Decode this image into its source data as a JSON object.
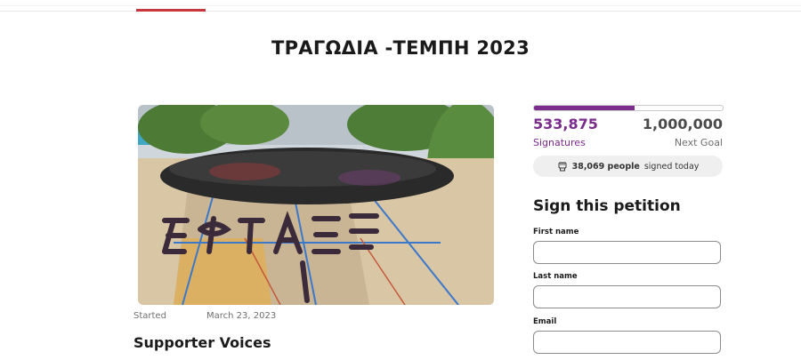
{
  "page": {
    "title": "ΤΡΑΓΩΔΙΑ -ΤΕΜΠΗ 2023"
  },
  "hero_image": {
    "description_icon": "photo-icon",
    "painted_text": "ΕΦΤΑΙΞΕΣ"
  },
  "meta": {
    "started_label": "Started",
    "started_date": "March 23, 2023"
  },
  "supporters": {
    "heading": "Supporter Voices"
  },
  "progress": {
    "signatures": "533,875",
    "signatures_label": "Signatures",
    "goal": "1,000,000",
    "goal_label": "Next Goal",
    "fraction": 0.534,
    "color": "#7a2b8c"
  },
  "today": {
    "icon": "raised-fist-icon",
    "count": "38,069 people",
    "suffix": "signed today"
  },
  "form": {
    "heading": "Sign this petition",
    "first_name_label": "First name",
    "first_name_value": "",
    "last_name_label": "Last name",
    "last_name_value": "",
    "email_label": "Email",
    "email_value": ""
  },
  "colors": {
    "accent": "#c6363c",
    "brand": "#7a2b8c"
  }
}
